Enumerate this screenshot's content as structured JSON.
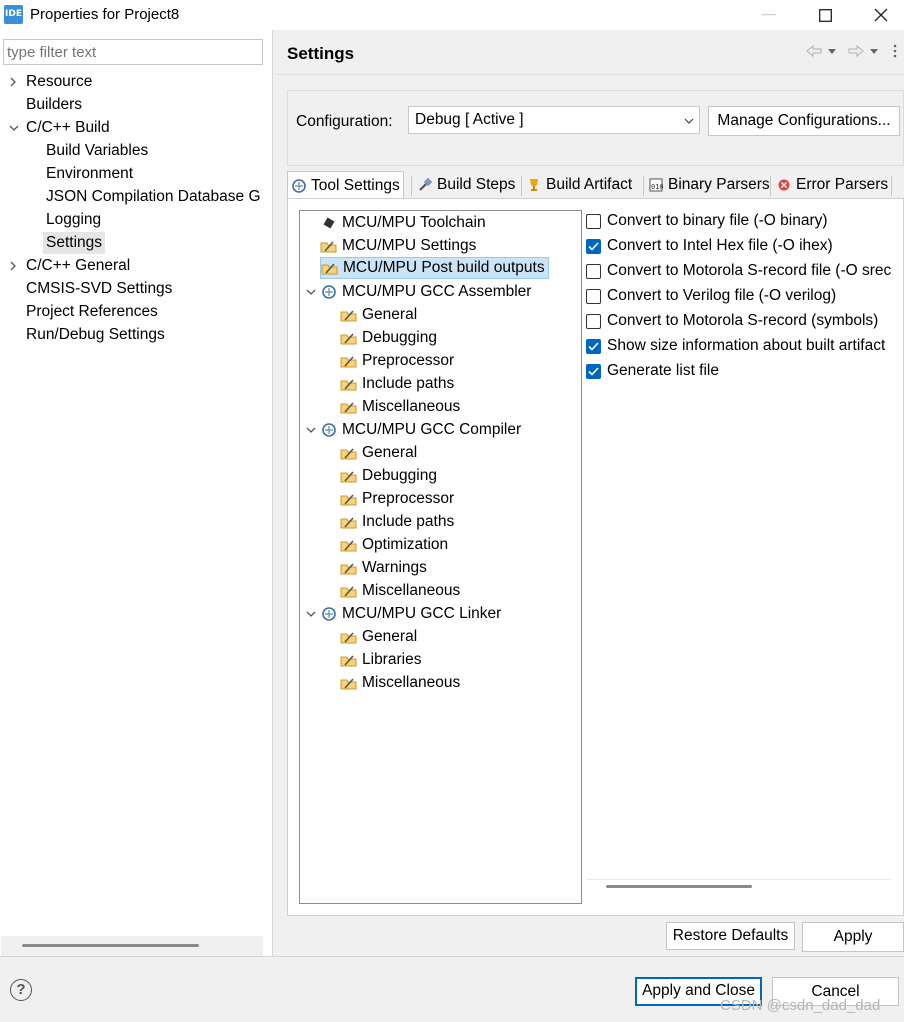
{
  "window": {
    "app_icon_text": "IDE",
    "title": "Properties for Project8"
  },
  "left": {
    "filter_placeholder": "type filter text",
    "items": [
      {
        "label": "Resource"
      },
      {
        "label": "Builders"
      },
      {
        "label": "C/C++ Build"
      },
      {
        "label": "Build Variables"
      },
      {
        "label": "Environment"
      },
      {
        "label": "JSON Compilation Database G"
      },
      {
        "label": "Logging"
      },
      {
        "label": "Settings"
      },
      {
        "label": "C/C++ General"
      },
      {
        "label": "CMSIS-SVD Settings"
      },
      {
        "label": "Project References"
      },
      {
        "label": "Run/Debug Settings"
      }
    ]
  },
  "right": {
    "title": "Settings",
    "configuration_label": "Configuration:",
    "configuration_value": "Debug  [ Active ]",
    "manage_button": "Manage Configurations...",
    "tabs": [
      {
        "label": "Tool Settings"
      },
      {
        "label": "Build Steps"
      },
      {
        "label": "Build Artifact"
      },
      {
        "label": "Binary Parsers"
      },
      {
        "label": "Error Parsers"
      }
    ],
    "tree": [
      {
        "label": "MCU/MPU Toolchain"
      },
      {
        "label": "MCU/MPU Settings"
      },
      {
        "label": "MCU/MPU Post build outputs"
      },
      {
        "label": "MCU/MPU GCC Assembler"
      },
      {
        "label": "General"
      },
      {
        "label": "Debugging"
      },
      {
        "label": "Preprocessor"
      },
      {
        "label": "Include paths"
      },
      {
        "label": "Miscellaneous"
      },
      {
        "label": "MCU/MPU GCC Compiler"
      },
      {
        "label": "General"
      },
      {
        "label": "Debugging"
      },
      {
        "label": "Preprocessor"
      },
      {
        "label": "Include paths"
      },
      {
        "label": "Optimization"
      },
      {
        "label": "Warnings"
      },
      {
        "label": "Miscellaneous"
      },
      {
        "label": "MCU/MPU GCC Linker"
      },
      {
        "label": "General"
      },
      {
        "label": "Libraries"
      },
      {
        "label": "Miscellaneous"
      }
    ],
    "options": [
      {
        "label": "Convert to binary file (-O binary)",
        "checked": false
      },
      {
        "label": "Convert to Intel Hex file (-O ihex)",
        "checked": true
      },
      {
        "label": "Convert to Motorola S-record file (-O srec)",
        "checked": false
      },
      {
        "label": "Convert to Verilog file (-O verilog)",
        "checked": false
      },
      {
        "label": "Convert to Motorola S-record (symbols)",
        "checked": false
      },
      {
        "label": "Show size information about built artifact",
        "checked": true
      },
      {
        "label": "Generate list file",
        "checked": true
      }
    ],
    "restore_button": "Restore Defaults",
    "apply_button": "Apply"
  },
  "footer": {
    "help": "?",
    "apply_close_button": "Apply and Close",
    "cancel_button": "Cancel",
    "watermark": "CSDN @csdn_dad_dad"
  },
  "colors": {
    "accent": "#0067c0",
    "selection": "#cce4f7",
    "app_icon": "#3b8fd6"
  }
}
